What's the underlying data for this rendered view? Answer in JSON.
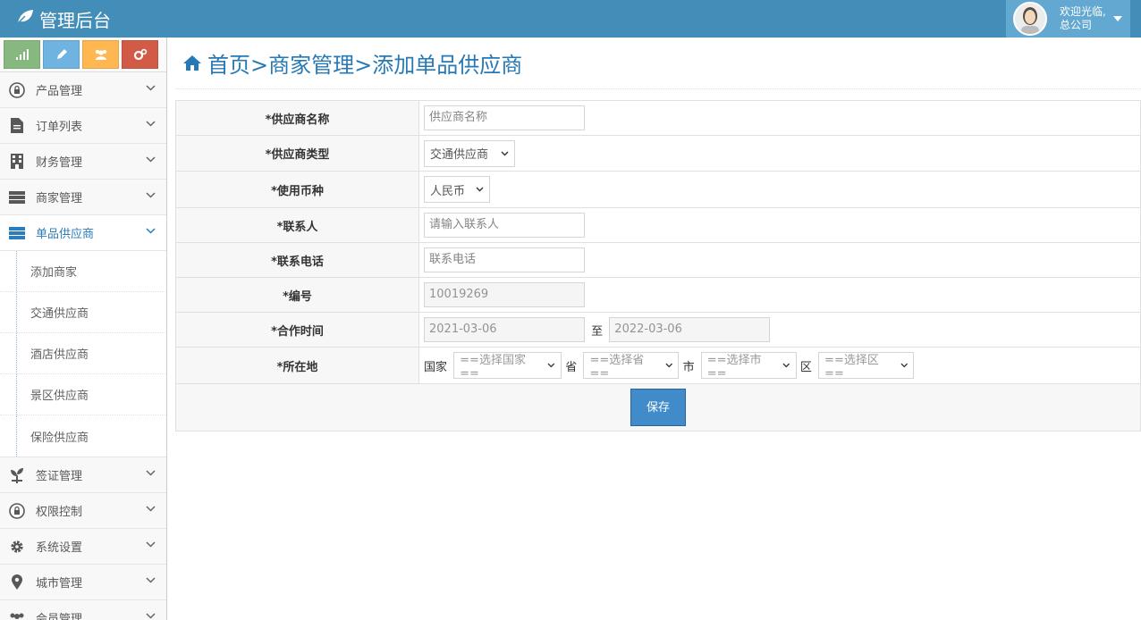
{
  "app": {
    "title": "管理后台"
  },
  "user": {
    "welcome": "欢迎光临,",
    "company": "总公司"
  },
  "shortcuts": [
    {
      "icon": "signal-icon",
      "color": "#87b87f"
    },
    {
      "icon": "pencil-icon",
      "color": "#6fb3e0"
    },
    {
      "icon": "users-icon",
      "color": "#ffb752"
    },
    {
      "icon": "cogs-icon",
      "color": "#d15b47"
    }
  ],
  "sidebar": {
    "items": [
      {
        "label": "产品管理",
        "icon": "lock-icon"
      },
      {
        "label": "订单列表",
        "icon": "file-icon"
      },
      {
        "label": "财务管理",
        "icon": "building-icon"
      },
      {
        "label": "商家管理",
        "icon": "server-icon"
      },
      {
        "label": "单品供应商",
        "icon": "server-icon"
      },
      {
        "label": "签证管理",
        "icon": "leaf-icon"
      },
      {
        "label": "权限控制",
        "icon": "lock-icon"
      },
      {
        "label": "系统设置",
        "icon": "gear-icon"
      },
      {
        "label": "城市管理",
        "icon": "map-marker-icon"
      },
      {
        "label": "会员管理",
        "icon": "users-icon"
      }
    ],
    "sub_items": [
      "添加商家",
      "交通供应商",
      "酒店供应商",
      "景区供应商",
      "保险供应商"
    ]
  },
  "breadcrumb": "首页>商家管理>添加单品供应商",
  "form": {
    "name_label": "*供应商名称",
    "name_placeholder": "供应商名称",
    "type_label": "*供应商类型",
    "type_value": "交通供应商",
    "currency_label": "*使用币种",
    "currency_value": "人民币",
    "contact_label": "*联系人",
    "contact_placeholder": "请输入联系人",
    "phone_label": "*联系电话",
    "phone_placeholder": "联系电话",
    "code_label": "*编号",
    "code_value": "10019269",
    "period_label": "*合作时间",
    "start_date": "2021-03-06",
    "to_text": "至",
    "end_date": "2022-03-06",
    "location_label": "*所在地",
    "country_text": "国家",
    "country_select": "==选择国家==",
    "province_text": "省",
    "province_select": "==选择省==",
    "city_text": "市",
    "city_select": "==选择市==",
    "district_text": "区",
    "district_select": "==选择区==",
    "save_label": "保存"
  }
}
